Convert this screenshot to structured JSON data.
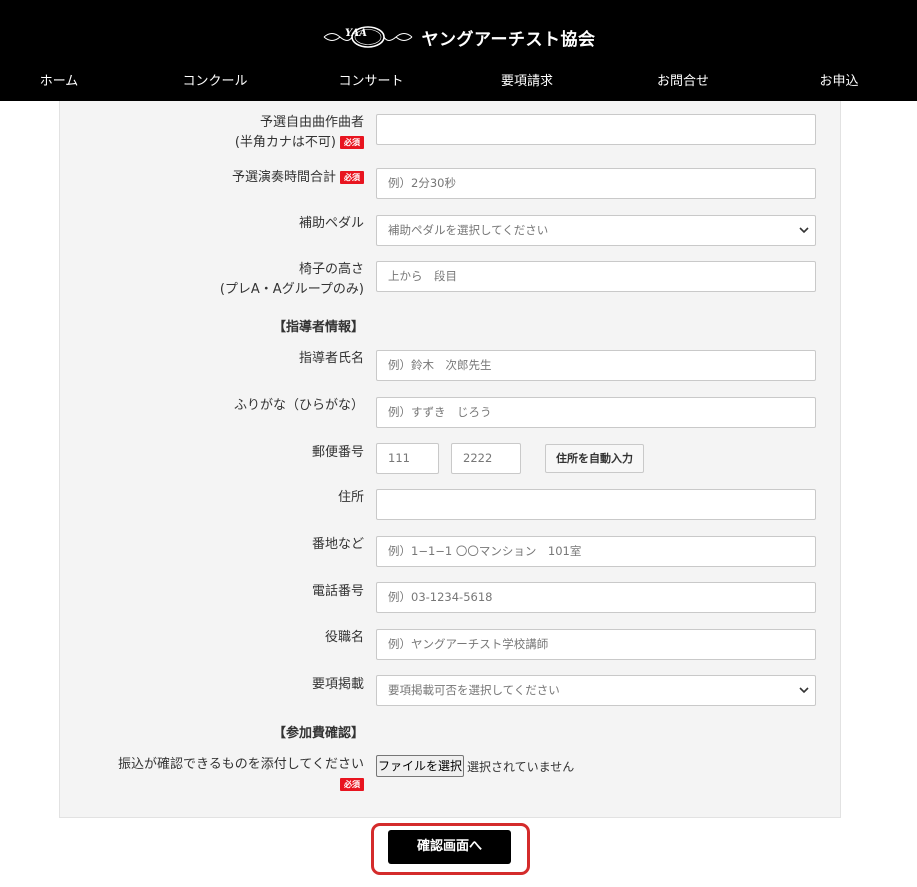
{
  "header": {
    "logo_text": "YAA",
    "title": "ヤングアーチスト協会",
    "nav": [
      "ホーム",
      "コンクール",
      "コンサート",
      "要項請求",
      "お問合せ",
      "お申込"
    ]
  },
  "form": {
    "required_badge": "必須",
    "composer": {
      "label_line1": "予選自由曲作曲者",
      "label_line2": "(半角カナは不可)",
      "value": ""
    },
    "duration": {
      "label": "予選演奏時間合計",
      "placeholder": "例）2分30秒"
    },
    "pedal": {
      "label": "補助ペダル",
      "selected": "補助ペダルを選択してください"
    },
    "chair": {
      "label_line1": "椅子の高さ",
      "label_line2": "(プレA・Aグループのみ)",
      "value": "上から　段目"
    },
    "section_teacher": "【指導者情報】",
    "teacher_name": {
      "label": "指導者氏名",
      "placeholder": "例）鈴木　次郎先生"
    },
    "teacher_kana": {
      "label": "ふりがな（ひらがな）",
      "placeholder": "例）すずき　じろう"
    },
    "postal": {
      "label": "郵便番号",
      "part1": "111",
      "part2": "2222",
      "autofill_button": "住所を自動入力"
    },
    "address": {
      "label": "住所",
      "value": ""
    },
    "street": {
      "label": "番地など",
      "placeholder": "例）1−1−1 〇〇マンション　101室"
    },
    "phone": {
      "label": "電話番号",
      "placeholder": "例）03-1234-5618"
    },
    "position": {
      "label": "役職名",
      "placeholder": "例）ヤングアーチスト学校講師"
    },
    "listing": {
      "label": "要項掲載",
      "selected": "要項掲載可否を選択してください"
    },
    "section_fee": "【参加費確認】",
    "transfer": {
      "label": "振込が確認できるものを添付してください",
      "file_button": "ファイルを選択",
      "file_status": "選択されていません"
    }
  },
  "submit_label": "確認画面へ"
}
